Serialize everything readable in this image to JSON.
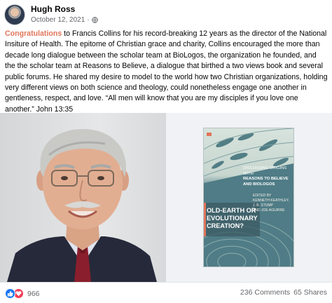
{
  "post": {
    "author": "Hugh Ross",
    "date": "October 12, 2021",
    "separator": "·",
    "text_highlight": "Congratulations",
    "text_body": " to Francis Collins for his record-breaking 12 years as the director of the National Insiture of Health. The epitome of Christian grace and charity, Collins encouraged the more than decade long dialogue between the scholar team at BioLogos, the organization he founded, and the the scholar team at Reasons to Believe, a dialogue that birthed a two views book and several public forums. He shared my desire to model to the world how two Christian organizations, holding very different views on both science and theology, could nonetheless engage one another in gentleness, respect, and love. “All men will know that you are my disciples if you love one another.” John 13:35",
    "privacy_icon": "globe-icon"
  },
  "book": {
    "subtitle_line1": "Discussing Origins with",
    "subtitle_line2": "Reasons to Believe",
    "subtitle_line3": "and BioLogos",
    "editors_label": "Edited by",
    "editor1": "Kenneth Keathley,",
    "editor2": "J. B. Stump",
    "editor3": "and Joe Aguirre",
    "title": "Old-Earth or Evolutionary Creation?"
  },
  "footer": {
    "reaction_count": "966",
    "comments": "236 Comments",
    "shares": "65 Shares"
  },
  "colors": {
    "highlight": "#e1755b",
    "like_blue": "#1877f2",
    "love_red": "#f33e58",
    "muted": "#65676b"
  }
}
